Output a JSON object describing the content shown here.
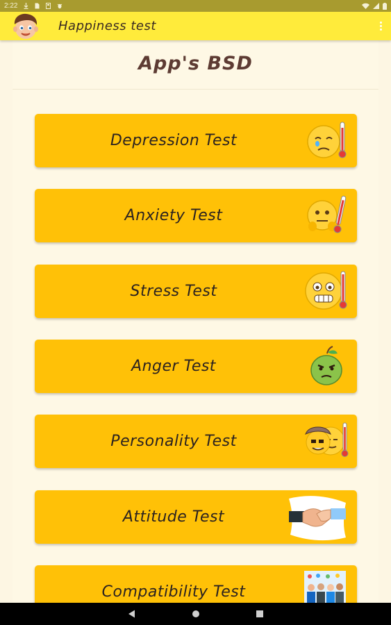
{
  "status_bar": {
    "time": "2:22",
    "icons": [
      "download-icon",
      "sim-icon",
      "storage-icon",
      "bug-icon"
    ],
    "right_icons": [
      "wifi-icon",
      "signal-icon",
      "battery-icon"
    ]
  },
  "app_bar": {
    "title": "Happiness test",
    "logo": "boy-face-icon",
    "menu": "overflow-menu-icon"
  },
  "page": {
    "title": "App's BSD"
  },
  "tests": [
    {
      "label": "Depression Test",
      "icon": "sad-thermometer-emoji-icon"
    },
    {
      "label": "Anxiety Test",
      "icon": "nervous-thermometer-emoji-icon"
    },
    {
      "label": "Stress Test",
      "icon": "stressed-thermometer-emoji-icon"
    },
    {
      "label": "Anger Test",
      "icon": "angry-apple-icon"
    },
    {
      "label": "Personality Test",
      "icon": "personality-emoji-icon"
    },
    {
      "label": "Attitude Test",
      "icon": "handshake-icon"
    },
    {
      "label": "Compatibility Test",
      "icon": "group-photo-icon"
    }
  ],
  "colors": {
    "status_bar": "#a89b2f",
    "app_bar": "#ffeb3b",
    "background": "#fdf6e3",
    "button": "#ffc107",
    "title_text": "#5d3b33",
    "button_text": "#2b2220"
  },
  "nav_bar": {
    "icons": [
      "back-icon",
      "home-icon",
      "recents-icon"
    ]
  }
}
